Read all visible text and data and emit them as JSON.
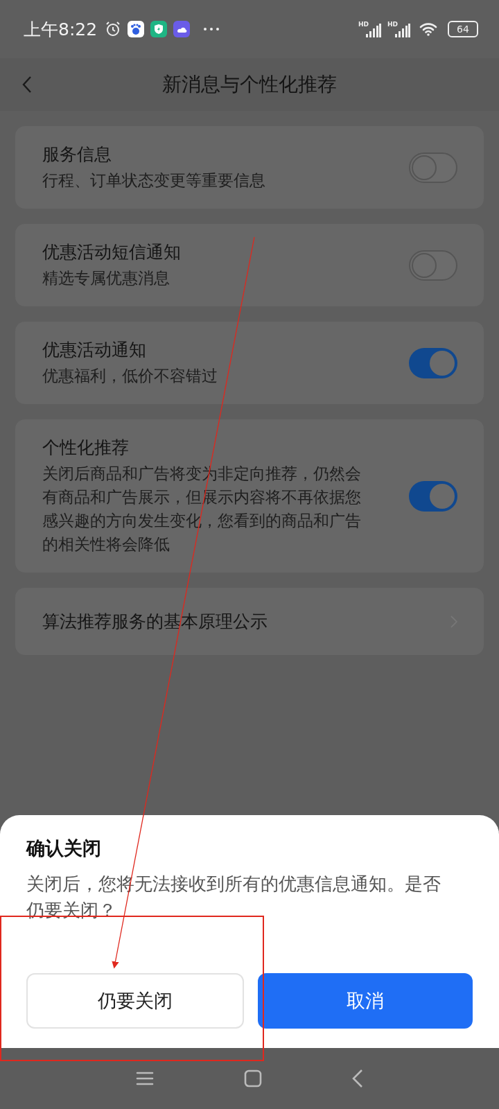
{
  "status_bar": {
    "time": "上午8:22",
    "signals": [
      {
        "label": "HD"
      },
      {
        "label": "HD"
      }
    ],
    "battery": "64"
  },
  "header": {
    "title": "新消息与个性化推荐"
  },
  "settings": [
    {
      "kind": "toggle",
      "title": "服务信息",
      "description": "行程、订单状态变更等重要信息",
      "on": false
    },
    {
      "kind": "toggle",
      "title": "优惠活动短信通知",
      "description": "精选专属优惠消息",
      "on": false
    },
    {
      "kind": "toggle",
      "title": "优惠活动通知",
      "description": "优惠福利，低价不容错过",
      "on": true
    },
    {
      "kind": "toggle",
      "title": "个性化推荐",
      "description": "关闭后商品和广告将变为非定向推荐，仍然会有商品和广告展示，但展示内容将不再依据您感兴趣的方向发生变化，您看到的商品和广告的相关性将会降低",
      "on": true
    },
    {
      "kind": "link",
      "title": "算法推荐服务的基本原理公示"
    }
  ],
  "dialog": {
    "title": "确认关闭",
    "message": "关闭后，您将无法接收到所有的优惠信息通知。是否仍要关闭？",
    "buttons": [
      {
        "kind": "secondary",
        "label": "仍要关闭"
      },
      {
        "kind": "primary",
        "label": "取消"
      }
    ]
  }
}
